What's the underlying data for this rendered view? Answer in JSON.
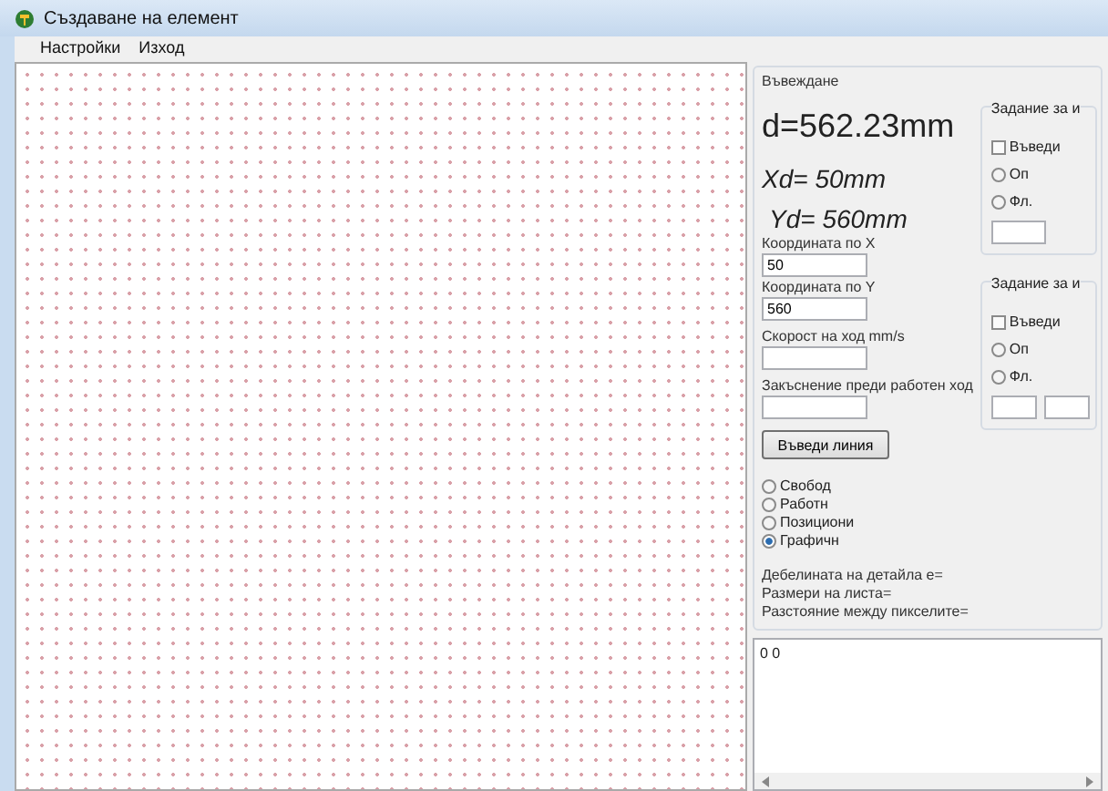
{
  "window": {
    "title": "Създаване на елемент"
  },
  "menu": [
    {
      "label": "Настройки"
    },
    {
      "label": "Изход"
    }
  ],
  "input_group": {
    "title": "Въвеждане",
    "distance": "d=562.23mm",
    "xd": "Xd= 50mm",
    "yd": "Yd= 560mm",
    "fields": [
      {
        "label": "Координата по X",
        "value": "50"
      },
      {
        "label": "Координата по Y",
        "value": "560"
      },
      {
        "label": "Скорост на ход mm/s"
      },
      {
        "label": "Закъснение преди работен ход"
      }
    ],
    "button": "Въведи линия",
    "modes": [
      {
        "label": "Свобод",
        "selected": false
      },
      {
        "label": "Работн",
        "selected": false
      },
      {
        "label": "Позициони",
        "selected": false
      },
      {
        "label": "Графичн",
        "selected": true
      }
    ],
    "info": [
      "Дебелината на детайла е=",
      "Размери на листа=",
      "Разстояние между пикселите="
    ],
    "subgroups": [
      {
        "title": "Задание за и",
        "kind": "single",
        "checkbox": {
          "label": "Въведи",
          "checked": false
        },
        "radios": [
          {
            "label": "Оп",
            "selected": false
          },
          {
            "label": "Фл.",
            "selected": false
          }
        ]
      },
      {
        "title": "Задание за и",
        "kind": "double",
        "checkbox": {
          "label": "Въведи",
          "checked": false
        },
        "radios": [
          {
            "label": "Оп",
            "selected": false
          },
          {
            "label": "Фл.",
            "selected": false
          }
        ]
      }
    ]
  },
  "output": {
    "text": "0 0"
  }
}
